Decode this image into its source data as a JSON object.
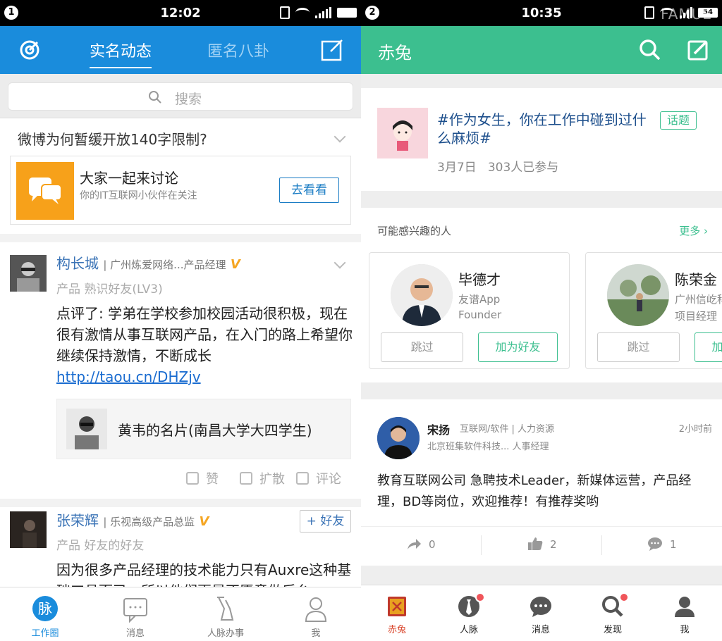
{
  "left": {
    "status": {
      "index": "1",
      "time": "12:02"
    },
    "header": {
      "tab_active": "实名动态",
      "tab_inactive": "匿名八卦",
      "left_icon": "radar-icon",
      "right_icon": "compose-icon"
    },
    "search": {
      "placeholder": "搜索"
    },
    "topic": {
      "question": "微博为何暂缓开放140字限制?",
      "card_title": "大家一起来讨论",
      "card_subtitle": "你的IT互联网小伙伴在关注",
      "card_button": "去看看"
    },
    "post1": {
      "name": "构长城",
      "org": "| 广州炼爱网络...产品经理",
      "badge": "V",
      "relation": "产品 熟识好友(LV3)",
      "body": "点评了: 学弟在学校参加校园活动很积极，现在很有激情从事互联网产品，在入门的路上希望你继续保持激情，不断成长",
      "link": "http://taou.cn/DHZjv",
      "shared_card": "黄韦的名片(南昌大学大四学生)",
      "actions": [
        "赞",
        "扩散",
        "评论"
      ]
    },
    "post2": {
      "name": "张荣辉",
      "org": "| 乐视高级产品总监",
      "badge": "V",
      "relation": "产品 好友的好友",
      "add_button": "+ 好友",
      "body": "因为很多产品经理的技术能力只有Auxre这种基础工具而已，所以他们更是不愿意做后台"
    },
    "nav": [
      {
        "label": "工作圈",
        "icon": "mai-icon"
      },
      {
        "label": "消息",
        "icon": "message-icon"
      },
      {
        "label": "人脉办事",
        "icon": "flask-icon"
      },
      {
        "label": "我",
        "icon": "person-icon"
      }
    ]
  },
  "right": {
    "status": {
      "index": "2",
      "time": "10:35",
      "battery": "54"
    },
    "watermark": "FAMUE",
    "header": {
      "title": "赤兔",
      "search_icon": "search-icon",
      "edit_icon": "edit-icon"
    },
    "topic": {
      "title": "#作为女生，你在工作中碰到过什么麻烦#",
      "tag": "话题",
      "date": "3月7日",
      "participants": "303人已参与"
    },
    "suggestions": {
      "title": "可能感兴趣的人",
      "more": "更多 ›",
      "people": [
        {
          "name": "毕德才",
          "line1": "友谱App",
          "line2": "Founder",
          "skip": "跳过",
          "add": "加为好友"
        },
        {
          "name": "陈荣金",
          "line1": "广州信屹科技",
          "line2": "项目经理",
          "skip": "跳过",
          "add": "加为好友"
        }
      ]
    },
    "post": {
      "name": "宋扬",
      "industry": "互联网/软件 | 人力资源",
      "time": "2小时前",
      "company": "北京班集软件科技... 人事经理",
      "body": "教育互联网公司 急聘技术Leader，新媒体运营，产品经理，BD等岗位，欢迎推荐！有推荐奖哟",
      "shares": "0",
      "likes": "2",
      "comments": "1"
    },
    "nav": [
      {
        "label": "赤兔",
        "icon": "chitu-icon"
      },
      {
        "label": "人脉",
        "icon": "tie-icon"
      },
      {
        "label": "消息",
        "icon": "chat-icon"
      },
      {
        "label": "发现",
        "icon": "discover-icon"
      },
      {
        "label": "我",
        "icon": "me-icon"
      }
    ],
    "colors": {
      "accent": "#3cbf8f",
      "active_nav": "#d9452b",
      "badge": "#f0555a"
    }
  }
}
